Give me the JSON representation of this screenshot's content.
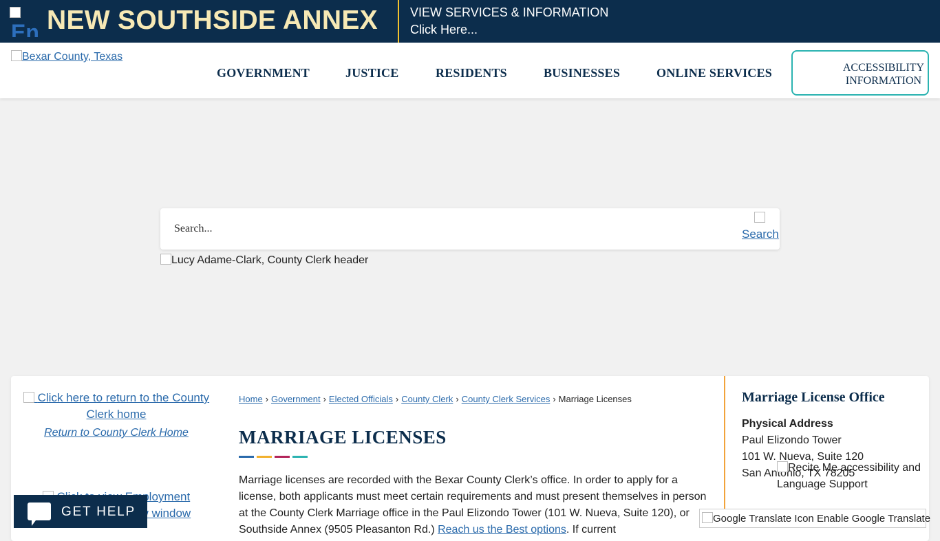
{
  "banner": {
    "icon_alt": "En",
    "title": "NEW SOUTHSIDE ANNEX",
    "line1": "VIEW SERVICES & INFORMATION",
    "line2": "Click Here..."
  },
  "header": {
    "logo_alt": "Bexar County, Texas",
    "nav": [
      "GOVERNMENT",
      "JUSTICE",
      "RESIDENTS",
      "BUSINESSES",
      "ONLINE SERVICES"
    ],
    "accessibility_line1": "ACCESSIBILITY",
    "accessibility_line2": "INFORMATION"
  },
  "search": {
    "placeholder": "Search...",
    "button_alt": "Search"
  },
  "header_image_alt": "Lucy Adame-Clark, County Clerk header",
  "left_column": {
    "return_image_alt": "Click here to return to the County Clerk home",
    "return_link": "Return to County Clerk Home",
    "employment_image_alt": "Click to view Employment Opportunities in new window"
  },
  "breadcrumb": {
    "items": [
      "Home",
      "Government",
      "Elected Officials",
      "County Clerk",
      "County Clerk Services"
    ],
    "current": "Marriage Licenses"
  },
  "page_title": "MARRIAGE LICENSES",
  "title_bar_colors": [
    "#2a6aab",
    "#f2b12e",
    "#b3245a",
    "#2bb3b1"
  ],
  "body": {
    "p1_a": "Marriage licenses are recorded with the Bexar County Clerk’s office. In order to apply for a license, both applicants must meet certain requirements and must present themselves in person at the County Clerk Marriage office in the Paul Elizondo Tower (101 W. Nueva, Suite 120), or Southside Annex (9505 Pleasanton Rd.) ",
    "p1_link": "Reach us the Best options",
    "p1_b": ". If current"
  },
  "sidebar": {
    "title": "Marriage License Office",
    "subtitle": "Physical Address",
    "address1": "Paul Elizondo Tower",
    "address2": "101 W. Nueva, Suite 120",
    "address3": "San Antonio, TX 78205"
  },
  "recite": {
    "alt": "Recite Me accessibility and Language Support"
  },
  "translate": {
    "icon_alt": "Google Translate Icon",
    "label": "Enable Google Translate"
  },
  "get_help": {
    "label": "GET HELP"
  }
}
